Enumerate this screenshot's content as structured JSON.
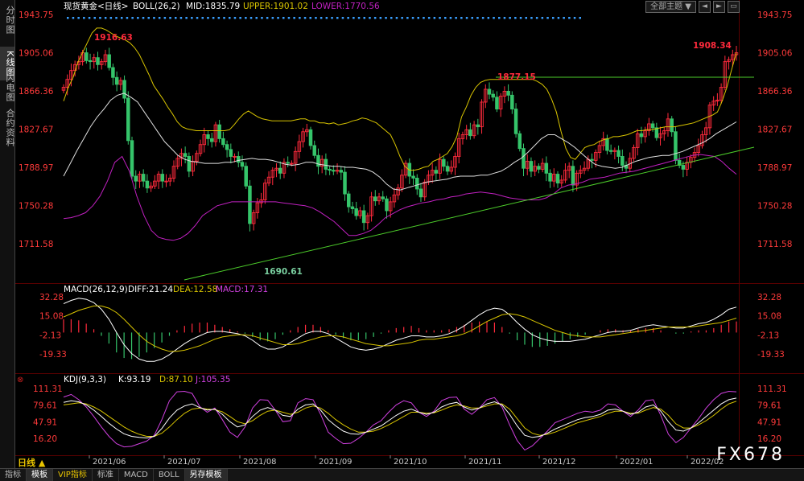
{
  "left_tabs": [
    "分时图",
    "K线图",
    "闪电图",
    "合约资料"
  ],
  "top_buttons": {
    "theme": "全部主题",
    "arrow": "▼",
    "icons": [
      "◄",
      "►",
      "▭"
    ]
  },
  "period": "日线 ▲",
  "bottom_tabs": [
    "指标",
    "模板",
    "VIP指标",
    "标准",
    "MACD",
    "BOLL",
    "另存模板"
  ],
  "watermark": "FX678",
  "colors": {
    "up": "#ff2a3c",
    "down": "#35c46a",
    "mid": "#e0e0e0",
    "upper": "#d8c400",
    "lower": "#c020c0",
    "trend": "#4ccc2a",
    "diff": "#ffffff",
    "dea": "#d8c400",
    "j": "#d040e0"
  },
  "chart_data": [
    {
      "type": "candlestick",
      "title": "现货黄金<日线>",
      "indicator": "BOLL(26,2)",
      "legend": [
        {
          "label": "MID:1835.79",
          "color": "#ffffff"
        },
        {
          "label": "UPPER:1901.02",
          "color": "#d8c400"
        },
        {
          "label": "LOWER:1770.56",
          "color": "#c020c0"
        }
      ],
      "y_ticks": [
        "1943.75",
        "1905.06",
        "1866.36",
        "1827.67",
        "1788.97",
        "1750.28",
        "1711.58"
      ],
      "y_tick_values": [
        1943.75,
        1905.06,
        1866.36,
        1827.67,
        1788.97,
        1750.28,
        1711.58
      ],
      "ylim": [
        1680,
        1943.75
      ],
      "x_ticks": [
        "2021/06",
        "2021/07",
        "2021/08",
        "2021/09",
        "2021/10",
        "2021/11",
        "2021/12",
        "2022/01",
        "2022/02"
      ],
      "annotations": [
        "1916.63",
        "1877.15",
        "1908.34",
        "1690.61"
      ],
      "close": [
        1870,
        1878,
        1887,
        1893,
        1896,
        1905,
        1897,
        1896,
        1900,
        1893,
        1896,
        1903,
        1890,
        1880,
        1873,
        1877,
        1859,
        1816,
        1780,
        1775,
        1782,
        1775,
        1768,
        1770,
        1775,
        1782,
        1775,
        1775,
        1778,
        1790,
        1798,
        1803,
        1800,
        1785,
        1795,
        1803,
        1812,
        1822,
        1818,
        1815,
        1832,
        1818,
        1812,
        1807,
        1800,
        1800,
        1794,
        1790,
        1770,
        1732,
        1743,
        1753,
        1756,
        1773,
        1779,
        1786,
        1788,
        1783,
        1794,
        1793,
        1793,
        1805,
        1815,
        1825,
        1827,
        1811,
        1801,
        1790,
        1797,
        1787,
        1786,
        1785,
        1786,
        1784,
        1762,
        1749,
        1747,
        1740,
        1745,
        1733,
        1740,
        1759,
        1755,
        1759,
        1757,
        1745,
        1754,
        1761,
        1768,
        1781,
        1793,
        1780,
        1778,
        1767,
        1759,
        1774,
        1781,
        1786,
        1783,
        1797,
        1790,
        1785,
        1789,
        1800,
        1818,
        1822,
        1827,
        1821,
        1832,
        1830,
        1855,
        1868,
        1863,
        1860,
        1848,
        1861,
        1866,
        1862,
        1848,
        1823,
        1808,
        1788,
        1795,
        1785,
        1790,
        1787,
        1793,
        1783,
        1775,
        1782,
        1773,
        1776,
        1786,
        1790,
        1771,
        1783,
        1786,
        1788,
        1797,
        1796,
        1804,
        1811,
        1818,
        1806,
        1805,
        1806,
        1800,
        1791,
        1788,
        1798,
        1809,
        1823,
        1820,
        1826,
        1833,
        1829,
        1819,
        1823,
        1826,
        1838,
        1825,
        1796,
        1791,
        1787,
        1794,
        1799,
        1804,
        1811,
        1822,
        1829,
        1852,
        1856,
        1857,
        1870,
        1896,
        1898,
        1903,
        1905
      ],
      "upper": [
        1856,
        1870,
        1880,
        1895,
        1905,
        1915,
        1925,
        1930,
        1930,
        1928,
        1925,
        1922,
        1920,
        1918,
        1915,
        1910,
        1903,
        1893,
        1883,
        1872,
        1865,
        1858,
        1850,
        1843,
        1835,
        1830,
        1828,
        1827,
        1826,
        1826,
        1826,
        1826,
        1826,
        1826,
        1826,
        1827,
        1832,
        1838,
        1843,
        1846,
        1843,
        1840,
        1838,
        1837,
        1836,
        1836,
        1836,
        1836,
        1836,
        1837,
        1838,
        1838,
        1836,
        1836,
        1834,
        1834,
        1833,
        1834,
        1832,
        1833,
        1834,
        1836,
        1837,
        1839,
        1838,
        1836,
        1834,
        1830,
        1826,
        1822,
        1812,
        1800,
        1790,
        1786,
        1786,
        1787,
        1789,
        1790,
        1795,
        1797,
        1800,
        1803,
        1810,
        1820,
        1840,
        1850,
        1862,
        1870,
        1875,
        1877,
        1878,
        1878,
        1878,
        1878,
        1878,
        1878,
        1878,
        1878,
        1878,
        1878,
        1876,
        1873,
        1868,
        1858,
        1845,
        1825,
        1808,
        1799,
        1797,
        1803,
        1809,
        1811,
        1812,
        1815,
        1817,
        1818,
        1820,
        1820,
        1821,
        1822,
        1824,
        1826,
        1826,
        1827,
        1827,
        1828,
        1829,
        1830,
        1830,
        1830,
        1831,
        1832,
        1833,
        1834,
        1836,
        1838,
        1840,
        1842,
        1845,
        1856,
        1870,
        1888,
        1905
      ],
      "mid": [
        1780,
        1793,
        1806,
        1818,
        1830,
        1840,
        1848,
        1857,
        1862,
        1864,
        1860,
        1855,
        1845,
        1835,
        1825,
        1815,
        1808,
        1801,
        1797,
        1795,
        1794,
        1793,
        1793,
        1793,
        1794,
        1794,
        1796,
        1797,
        1798,
        1797,
        1797,
        1796,
        1794,
        1792,
        1791,
        1792,
        1794,
        1794,
        1792,
        1791,
        1790,
        1790,
        1789,
        1789,
        1788,
        1787,
        1784,
        1779,
        1772,
        1767,
        1766,
        1768,
        1770,
        1772,
        1774,
        1775,
        1776,
        1777,
        1779,
        1780,
        1780,
        1780,
        1781,
        1781,
        1783,
        1785,
        1789,
        1794,
        1798,
        1804,
        1811,
        1818,
        1822,
        1822,
        1818,
        1814,
        1809,
        1803,
        1797,
        1792,
        1790,
        1789,
        1788,
        1789,
        1792,
        1795,
        1797,
        1799,
        1800,
        1801,
        1801,
        1803,
        1805,
        1808,
        1811,
        1814,
        1818,
        1823,
        1827,
        1831,
        1835
      ],
      "lower": [
        1737,
        1738,
        1740,
        1743,
        1750,
        1760,
        1775,
        1794,
        1800,
        1785,
        1760,
        1740,
        1725,
        1718,
        1716,
        1715,
        1717,
        1722,
        1730,
        1740,
        1745,
        1750,
        1752,
        1754,
        1754,
        1754,
        1754,
        1754,
        1754,
        1754,
        1753,
        1752,
        1751,
        1750,
        1748,
        1744,
        1739,
        1734,
        1727,
        1720,
        1720,
        1722,
        1725,
        1731,
        1738,
        1742,
        1746,
        1749,
        1751,
        1753,
        1754,
        1756,
        1757,
        1759,
        1760,
        1762,
        1763,
        1764,
        1763,
        1762,
        1760,
        1758,
        1757,
        1756,
        1756,
        1756,
        1758,
        1762,
        1768,
        1771,
        1772,
        1774,
        1777,
        1778,
        1779,
        1781,
        1783,
        1784,
        1785,
        1787,
        1789,
        1791,
        1793,
        1795,
        1797,
        1799,
        1801,
        1802,
        1801,
        1800,
        1795,
        1788,
        1782
      ]
    },
    {
      "type": "bar_line",
      "title": "MACD(26,12,9)",
      "legend": [
        {
          "label": "DIFF:21.24",
          "color": "#ffffff"
        },
        {
          "label": "DEA:12.58",
          "color": "#d8c400"
        },
        {
          "label": "MACD:17.31",
          "color": "#d040e0"
        }
      ],
      "y_ticks": [
        "32.28",
        "15.08",
        "-2.13",
        "-19.33"
      ],
      "y_tick_values": [
        32.28,
        15.08,
        -2.13,
        -19.33
      ],
      "ylim": [
        -35,
        40
      ],
      "diff": [
        26,
        29,
        31,
        30,
        27,
        21,
        12,
        0,
        -11,
        -19,
        -24,
        -26,
        -26,
        -24,
        -20,
        -15,
        -10,
        -6,
        -3,
        0,
        1,
        1,
        0,
        -1,
        -3,
        -7,
        -12,
        -15,
        -15,
        -13,
        -9,
        -5,
        -1,
        1,
        1,
        -1,
        -5,
        -9,
        -13,
        -15,
        -16,
        -15,
        -13,
        -10,
        -7,
        -5,
        -3,
        -3,
        -4,
        -4,
        -3,
        -1,
        2,
        6,
        11,
        16,
        20,
        22,
        21,
        16,
        9,
        3,
        -2,
        -5,
        -7,
        -8,
        -8,
        -8,
        -7,
        -6,
        -4,
        -2,
        0,
        1,
        1,
        2,
        4,
        6,
        7,
        6,
        5,
        4,
        4,
        6,
        8,
        9,
        12,
        16,
        21,
        23
      ],
      "dea": [
        14,
        17,
        20,
        22,
        24,
        24,
        22,
        18,
        12,
        5,
        -2,
        -8,
        -12,
        -15,
        -17,
        -17,
        -16,
        -14,
        -12,
        -9,
        -6,
        -4,
        -3,
        -2,
        -2,
        -3,
        -5,
        -7,
        -9,
        -11,
        -11,
        -10,
        -8,
        -6,
        -4,
        -3,
        -3,
        -4,
        -6,
        -8,
        -10,
        -11,
        -12,
        -12,
        -11,
        -10,
        -9,
        -7,
        -6,
        -6,
        -5,
        -4,
        -3,
        -1,
        2,
        6,
        10,
        13,
        16,
        17,
        16,
        14,
        11,
        8,
        5,
        2,
        0,
        -2,
        -3,
        -4,
        -4,
        -4,
        -3,
        -2,
        -1,
        0,
        1,
        2,
        3,
        4,
        5,
        5,
        5,
        5,
        6,
        7,
        8,
        9,
        11,
        13
      ],
      "macd": [
        12,
        12,
        11,
        8,
        3,
        -3,
        -10,
        -18,
        -23,
        -24,
        -22,
        -18,
        -14,
        -9,
        -3,
        2,
        6,
        8,
        9,
        9,
        7,
        5,
        3,
        1,
        -1,
        -4,
        -7,
        -8,
        -6,
        -2,
        2,
        5,
        7,
        7,
        5,
        2,
        -2,
        -5,
        -7,
        -7,
        -6,
        -4,
        -1,
        2,
        4,
        5,
        6,
        4,
        2,
        2,
        2,
        3,
        5,
        7,
        9,
        10,
        10,
        9,
        5,
        -1,
        -7,
        -11,
        -13,
        -13,
        -12,
        -10,
        -8,
        -6,
        -4,
        -2,
        0,
        2,
        3,
        3,
        2,
        2,
        3,
        4,
        4,
        2,
        0,
        -1,
        -1,
        1,
        2,
        2,
        4,
        7,
        10,
        10
      ]
    },
    {
      "type": "line",
      "title": "KDJ(9,3,3)",
      "legend": [
        {
          "label": "K:93.19",
          "color": "#ffffff"
        },
        {
          "label": "D:87.10",
          "color": "#d8c400"
        },
        {
          "label": "J:105.35",
          "color": "#d040e0"
        }
      ],
      "y_ticks": [
        "111.31",
        "79.61",
        "47.91",
        "16.20"
      ],
      "y_tick_values": [
        111.31,
        79.61,
        47.91,
        16.2
      ],
      "ylim": [
        -5,
        125
      ],
      "k": [
        85,
        88,
        86,
        80,
        70,
        58,
        45,
        34,
        25,
        20,
        18,
        17,
        20,
        35,
        55,
        70,
        78,
        82,
        75,
        70,
        72,
        62,
        48,
        38,
        42,
        58,
        70,
        75,
        70,
        60,
        58,
        72,
        80,
        82,
        70,
        52,
        40,
        30,
        25,
        24,
        28,
        34,
        40,
        50,
        60,
        68,
        72,
        66,
        62,
        66,
        76,
        82,
        85,
        76,
        70,
        74,
        82,
        86,
        80,
        62,
        40,
        22,
        18,
        20,
        26,
        34,
        40,
        46,
        52,
        56,
        58,
        62,
        70,
        72,
        68,
        62,
        66,
        76,
        80,
        68,
        48,
        32,
        30,
        36,
        46,
        58,
        70,
        82,
        90,
        93
      ],
      "d": [
        80,
        82,
        84,
        82,
        76,
        68,
        58,
        48,
        38,
        30,
        24,
        20,
        20,
        26,
        38,
        52,
        64,
        72,
        74,
        72,
        71,
        67,
        58,
        48,
        44,
        50,
        60,
        68,
        70,
        66,
        62,
        66,
        74,
        78,
        74,
        64,
        52,
        42,
        34,
        28,
        28,
        30,
        35,
        42,
        50,
        58,
        66,
        66,
        64,
        65,
        70,
        76,
        80,
        78,
        74,
        74,
        78,
        82,
        82,
        72,
        54,
        36,
        26,
        22,
        24,
        28,
        34,
        40,
        46,
        50,
        54,
        58,
        64,
        68,
        68,
        64,
        64,
        70,
        75,
        72,
        60,
        44,
        36,
        36,
        42,
        50,
        60,
        72,
        82,
        87
      ],
      "j": [
        95,
        100,
        90,
        76,
        58,
        38,
        20,
        6,
        0,
        1,
        6,
        11,
        22,
        52,
        88,
        105,
        106,
        102,
        77,
        66,
        74,
        52,
        28,
        18,
        38,
        74,
        90,
        89,
        70,
        48,
        50,
        84,
        92,
        90,
        62,
        28,
        16,
        6,
        7,
        16,
        28,
        42,
        50,
        66,
        80,
        88,
        84,
        66,
        58,
        68,
        88,
        94,
        95,
        72,
        62,
        74,
        90,
        94,
        76,
        42,
        12,
        -6,
        2,
        16,
        30,
        46,
        52,
        58,
        64,
        68,
        66,
        70,
        82,
        80,
        68,
        58,
        70,
        88,
        90,
        60,
        24,
        8,
        18,
        36,
        54,
        74,
        90,
        102,
        106,
        105
      ]
    }
  ]
}
